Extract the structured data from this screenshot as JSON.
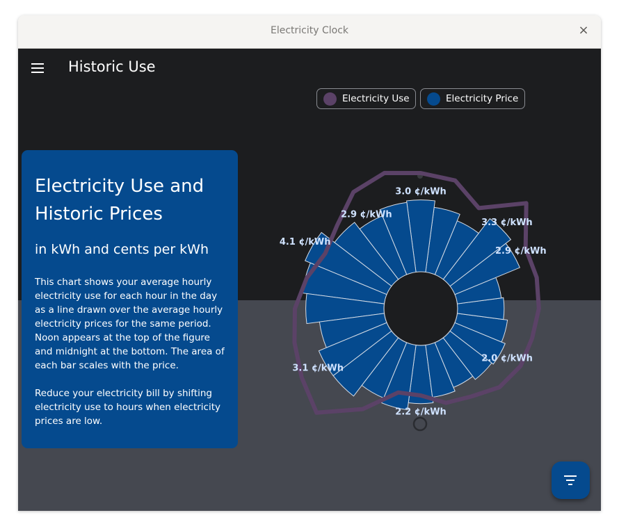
{
  "window": {
    "title": "Electricity Clock",
    "close_glyph": "×"
  },
  "app_bar": {
    "title": "Historic Use",
    "menu_icon": "hamburger-menu-icon"
  },
  "legend": [
    {
      "label": "Electricity Use",
      "color": "#5b4267"
    },
    {
      "label": "Electricity Price",
      "color": "#054a8e"
    }
  ],
  "info_card": {
    "heading": "Electricity Use and Historic Prices",
    "subheading": "in kWh and cents per kWh",
    "paragraph1": "This chart shows your average hourly electricity use for each hour in the day as a line drawn over the average hourly electricity prices for the same period. Noon appears at the top of the figure and midnight at the bottom. The area of each bar scales with the price.",
    "paragraph2": "Reduce your electricity bill by shifting electricity use to hours when electricity prices are low."
  },
  "fab": {
    "icon": "filter-list-icon"
  },
  "colors": {
    "bar": "#054a8e",
    "use_line": "#5b4267",
    "label_text": "#cfe2ff"
  },
  "chart_data": {
    "type": "radial-bar",
    "description_top": "noon",
    "description_bottom": "midnight",
    "price_labels": [
      {
        "hour": 12,
        "text": "3.0 ¢/kWh"
      },
      {
        "hour": 14,
        "text": "2.9 ¢/kWh"
      },
      {
        "hour": 16,
        "text": "4.1 ¢/kWh"
      },
      {
        "hour": 20,
        "text": "3.1 ¢/kWh"
      },
      {
        "hour": 0,
        "text": "2.2 ¢/kWh"
      },
      {
        "hour": 4,
        "text": "2.0 ¢/kWh"
      },
      {
        "hour": 8,
        "text": "2.9 ¢/kWh"
      },
      {
        "hour": 9,
        "text": "3.3 ¢/kWh"
      }
    ],
    "series": [
      {
        "name": "Electricity Price",
        "unit": "¢/kWh",
        "hours": [
          0,
          1,
          2,
          3,
          4,
          5,
          6,
          7,
          8,
          9,
          10,
          11,
          12,
          13,
          14,
          15,
          16,
          17,
          18,
          19,
          20,
          21,
          22,
          23
        ],
        "values": [
          2.2,
          1.9,
          1.7,
          1.9,
          2.0,
          1.8,
          1.6,
          1.5,
          2.9,
          3.3,
          2.2,
          2.6,
          3.0,
          2.9,
          2.5,
          3.0,
          4.1,
          3.7,
          3.4,
          2.6,
          3.1,
          3.1,
          2.3,
          2.6
        ]
      },
      {
        "name": "Electricity Use",
        "unit": "kWh",
        "hours": [
          0,
          1,
          2,
          3,
          4,
          5,
          6,
          7,
          8,
          9,
          10,
          11,
          12,
          13,
          14,
          15,
          16,
          17,
          18,
          19,
          20,
          21,
          22,
          23
        ],
        "values": [
          0.5,
          0.61,
          0.65,
          0.75,
          0.79,
          0.79,
          0.82,
          0.84,
          0.85,
          1.14,
          0.8,
          0.97,
          1.0,
          1.05,
          0.99,
          0.82,
          0.74,
          0.82,
          0.9,
          0.95,
          1.02,
          1.12,
          0.8,
          0.5
        ]
      }
    ]
  }
}
